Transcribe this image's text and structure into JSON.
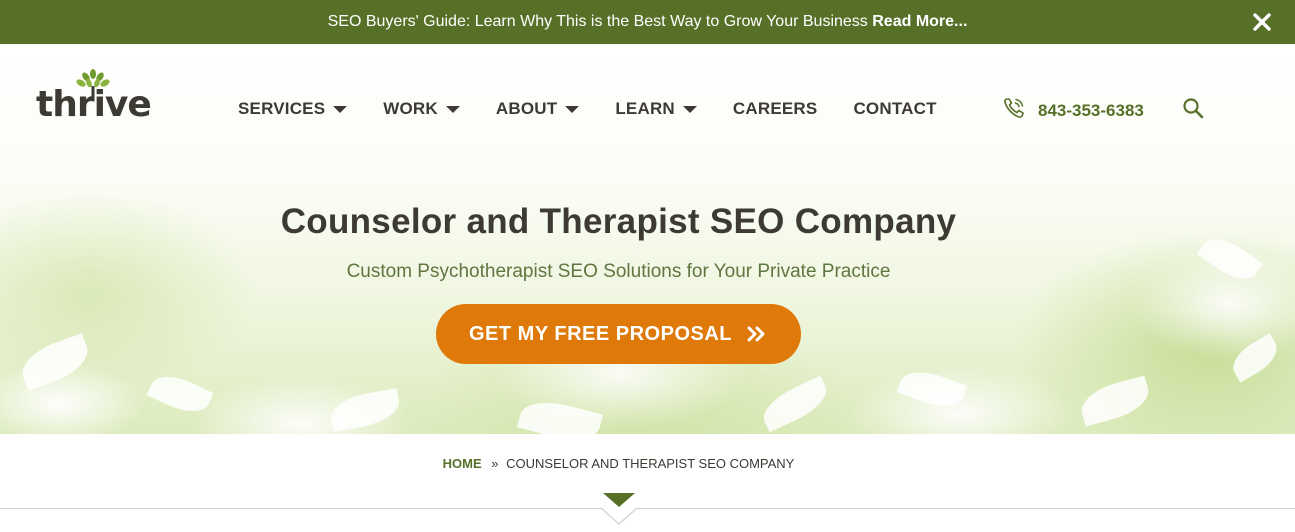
{
  "topbar": {
    "promo_text": "SEO Buyers' Guide: Learn Why This is the Best Way to Grow Your Business",
    "promo_link": "Read More...",
    "close_icon": "close-icon"
  },
  "header": {
    "logo_text": "thrive",
    "nav": [
      {
        "label": "SERVICES",
        "has_dropdown": true
      },
      {
        "label": "WORK",
        "has_dropdown": true
      },
      {
        "label": "ABOUT",
        "has_dropdown": true
      },
      {
        "label": "LEARN",
        "has_dropdown": true
      },
      {
        "label": "CAREERS",
        "has_dropdown": false
      },
      {
        "label": "CONTACT",
        "has_dropdown": false
      }
    ],
    "phone": "843-353-6383",
    "phone_icon": "phone-icon",
    "search_icon": "search-icon"
  },
  "hero": {
    "title": "Counselor and Therapist SEO Company",
    "subtitle": "Custom Psychotherapist SEO Solutions for Your Private Practice",
    "cta_label": "GET MY FREE PROPOSAL"
  },
  "breadcrumb": {
    "home": "HOME",
    "separator": "»",
    "current": "COUNSELOR AND THERAPIST SEO COMPANY"
  },
  "colors": {
    "brand_green": "#567028",
    "cta_orange": "#df7a0a",
    "text_dark": "#3d3a33"
  }
}
